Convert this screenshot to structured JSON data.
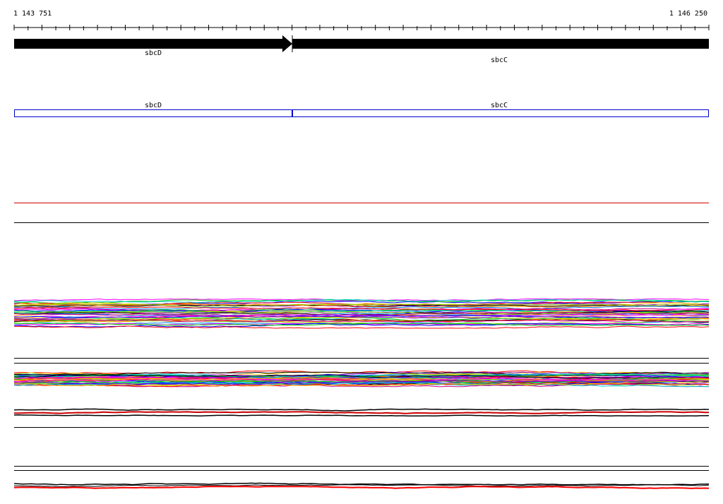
{
  "ruler": {
    "start_label": "1 143 751",
    "end_label": "1 146 250"
  },
  "genes_track": {
    "genes": [
      {
        "name": "sbcD",
        "strand": "+"
      },
      {
        "name": "sbcC",
        "strand": "+"
      }
    ]
  },
  "cds_track": {
    "genes": [
      {
        "name": "sbcD"
      },
      {
        "name": "sbcC"
      }
    ],
    "color": "#0000cc"
  },
  "colors": {
    "red_line": "#cc0000",
    "divider": "#000000",
    "series_palette": [
      "#ff00ff",
      "#0000ff",
      "#00cc00",
      "#ff0000",
      "#00cccc",
      "#ffcc00",
      "#8800cc",
      "#000000",
      "#ff8800",
      "#0088ff",
      "#88cc00",
      "#cc0088"
    ]
  }
}
